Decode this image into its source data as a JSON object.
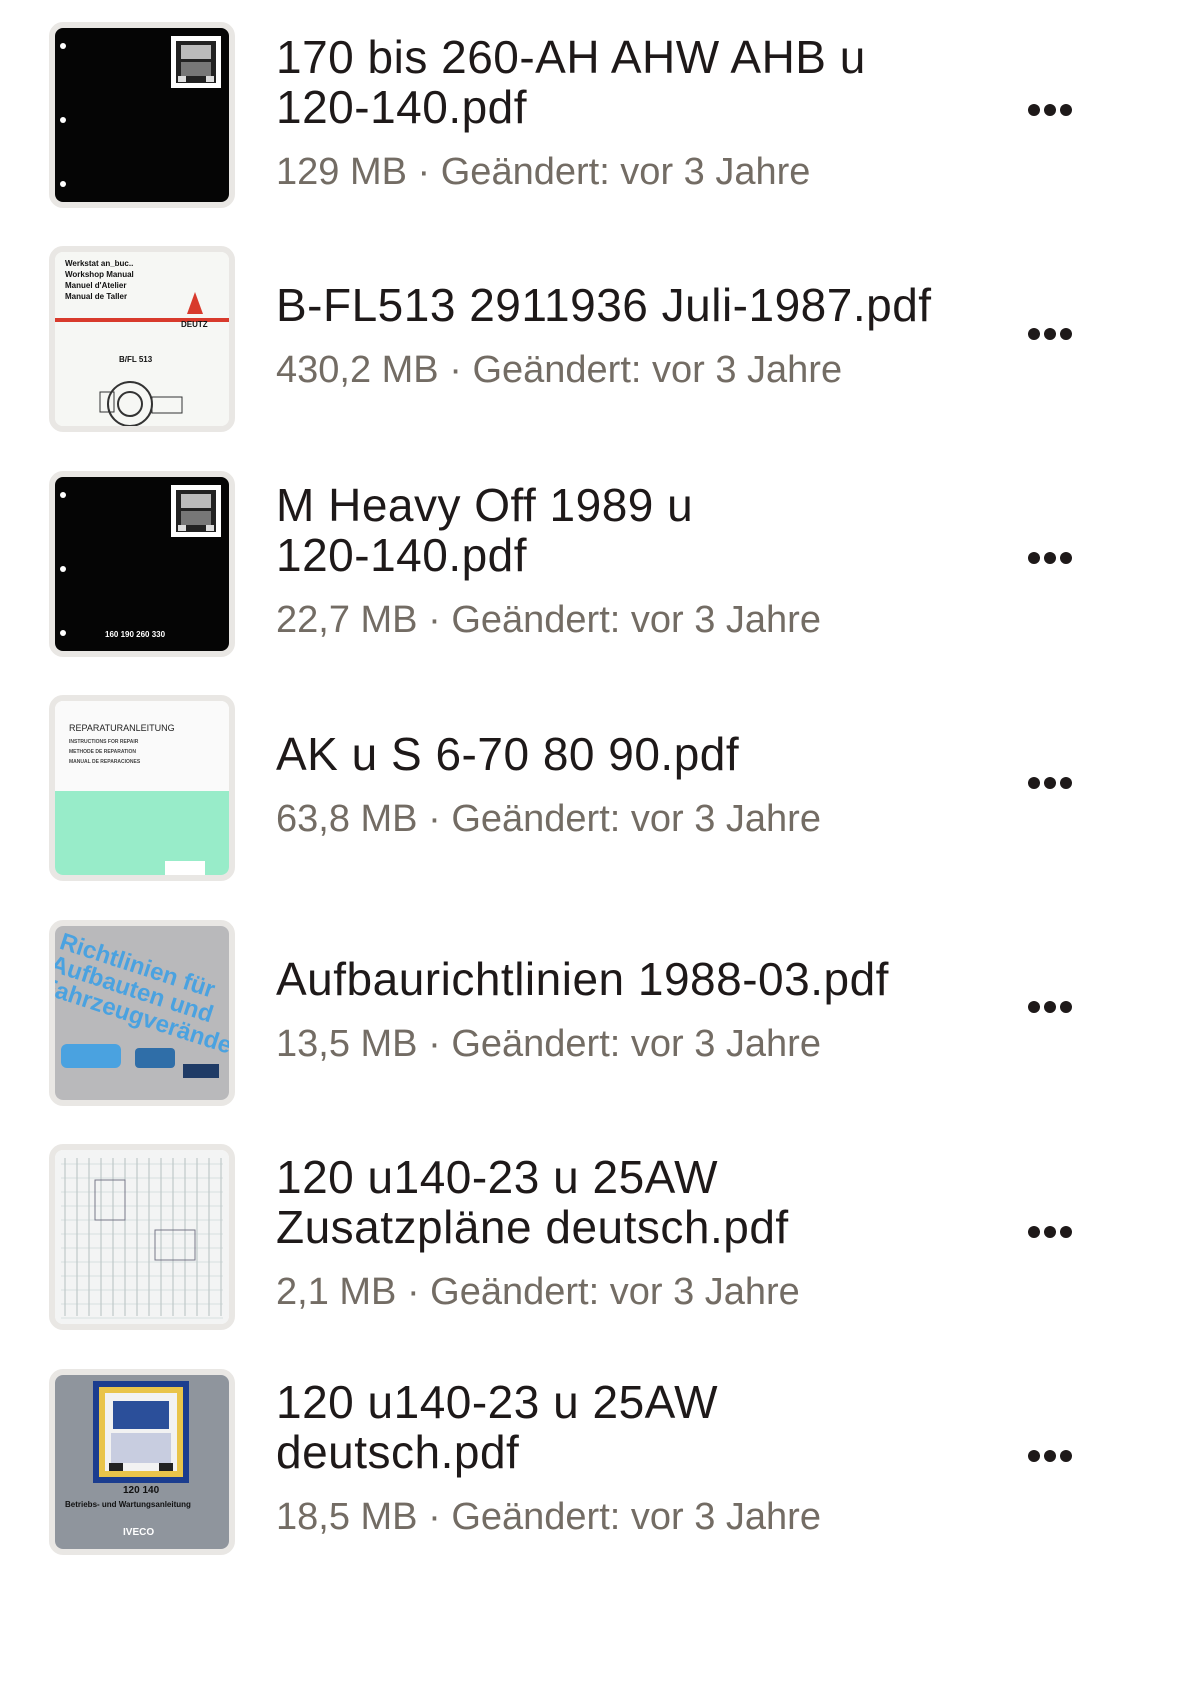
{
  "files": [
    {
      "name_line1": "170 bis 260-AH AHW AHB u",
      "name_line2": "120-140.pdf",
      "size": "129 MB",
      "modified": "Geändert: vor 3 Jahre",
      "thumb": "black-truck"
    },
    {
      "name_line1": "B-FL513 2911936 Juli-1987.pdf",
      "name_line2": "",
      "size": "430,2 MB",
      "modified": "Geändert: vor 3 Jahre",
      "thumb": "deutz-manual",
      "thumb_text": {
        "l1": "Werkstat   an_buc..",
        "l2": "Workshop Manual",
        "l3": "Manuel d'Atelier",
        "l4": "Manual de Taller",
        "brand": "DEUTZ",
        "model": "B/FL 513"
      }
    },
    {
      "name_line1": "M Heavy Off 1989 u",
      "name_line2": "120-140.pdf",
      "size": "22,7 MB",
      "modified": "Geändert: vor 3 Jahre",
      "thumb": "black-truck",
      "thumb_text": {
        "numbers": "160  190  260  330"
      }
    },
    {
      "name_line1": "AK u S 6-70 80 90.pdf",
      "name_line2": "",
      "size": "63,8 MB",
      "modified": "Geändert: vor 3 Jahre",
      "thumb": "repair-manual",
      "thumb_text": {
        "l1": "REPARATURANLEITUNG",
        "l2": "INSTRUCTIONS FOR REPAIR",
        "l3": "METHODE DE REPARATION",
        "l4": "MANUAL DE REPARACIONES"
      }
    },
    {
      "name_line1": "Aufbaurichtlinien 1988-03.pdf",
      "name_line2": "",
      "size": "13,5 MB",
      "modified": "Geändert: vor 3 Jahre",
      "thumb": "blue-guidelines",
      "thumb_text": {
        "l1": "Richtlinien für",
        "l2": "Aufbauten und",
        "l3": "Fahrzeugveränderungen"
      }
    },
    {
      "name_line1": "120 u140-23 u 25AW",
      "name_line2": "Zusatzpläne deutsch.pdf",
      "size": "2,1 MB",
      "modified": "Geändert: vor 3 Jahre",
      "thumb": "wiring-diagram"
    },
    {
      "name_line1": "120 u140-23 u 25AW",
      "name_line2": "deutsch.pdf",
      "size": "18,5 MB",
      "modified": "Geändert: vor 3 Jahre",
      "thumb": "iveco-manual",
      "thumb_text": {
        "numbers": "120   140",
        "l1": "Betriebs- und Wartungsanleitung",
        "brand": "IVECO"
      }
    }
  ],
  "separator": " · ",
  "more_icon": "more-horizontal-icon"
}
